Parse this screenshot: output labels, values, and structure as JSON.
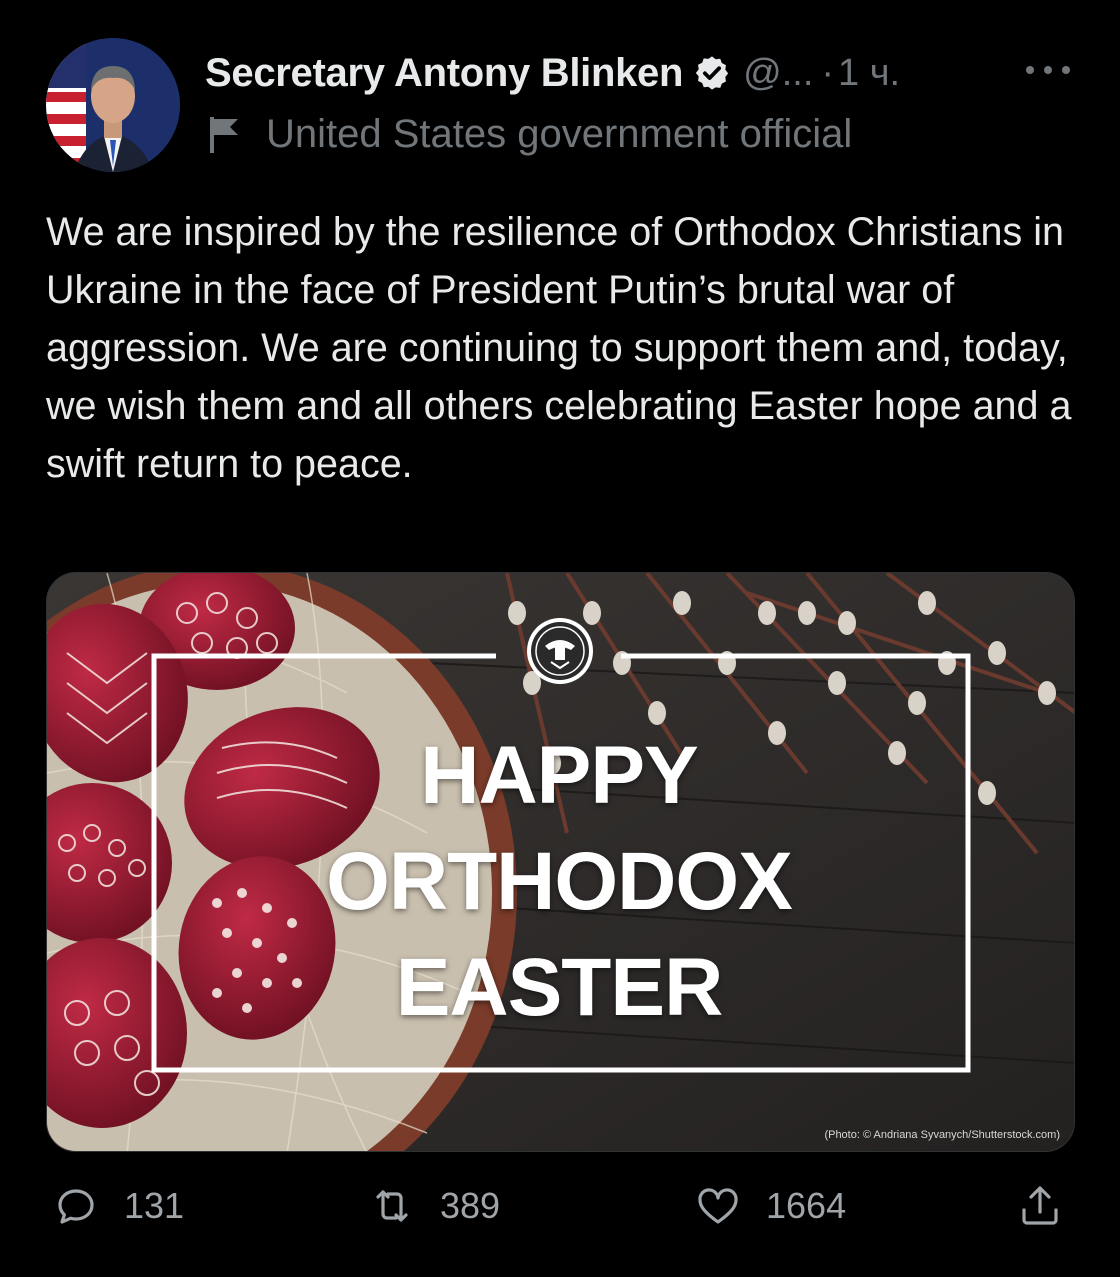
{
  "header": {
    "display_name": "Secretary Antony Blinken",
    "handle": "@...",
    "separator": "·",
    "time": "1 ч.",
    "label": "United States government official"
  },
  "tweet": {
    "text": "We are inspired by the resilience of Orthodox Christians in Ukraine in the face of President Putin’s brutal war of aggression. We are continuing to support them and, today, we wish them and all others celebrating Easter hope and a swift return to peace."
  },
  "media": {
    "headline_line1": "HAPPY",
    "headline_line2": "ORTHODOX",
    "headline_line3": "EASTER",
    "credit": "(Photo: © Andriana Syvanych/Shutterstock.com)"
  },
  "actions": {
    "replies": "131",
    "retweets": "389",
    "likes": "1664"
  },
  "colors": {
    "background": "#000000",
    "text": "#e7e9ea",
    "muted": "#71767b",
    "egg_red": "#9b1b30"
  },
  "icons": [
    "verified-badge-icon",
    "flag-icon",
    "more-icon",
    "reply-icon",
    "retweet-icon",
    "like-icon",
    "share-icon"
  ]
}
